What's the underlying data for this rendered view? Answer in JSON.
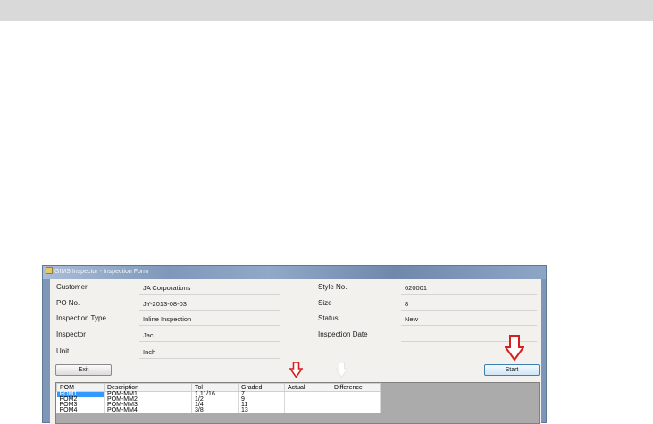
{
  "window": {
    "title": "GIMS Inspector - Inspection Form"
  },
  "form": {
    "fields_left": [
      {
        "label": "Customer",
        "value": "JA Corporations"
      },
      {
        "label": "PO No.",
        "value": "JY-2013-08-03"
      },
      {
        "label": "Inspection Type",
        "value": "Inline Inspection"
      },
      {
        "label": "Inspector",
        "value": "Jac"
      },
      {
        "label": "Unit",
        "value": "Inch"
      }
    ],
    "fields_right": [
      {
        "label": "Style No.",
        "value": "620001"
      },
      {
        "label": "Size",
        "value": "8"
      },
      {
        "label": "Status",
        "value": "New"
      },
      {
        "label": "Inspection Date",
        "value": ""
      }
    ]
  },
  "buttons": {
    "exit_label": "Exit",
    "start_label": "Start"
  },
  "table": {
    "columns": [
      "POM",
      "Description",
      "Tol",
      "Graded",
      "Actual",
      "Difference"
    ],
    "rows": [
      {
        "pom": "POM1",
        "description": "POM-MM1",
        "tol": "1 11/16",
        "graded": "7",
        "actual": "",
        "difference": ""
      },
      {
        "pom": "POM2",
        "description": "POM-MM2",
        "tol": "1/2",
        "graded": "9",
        "actual": "",
        "difference": ""
      },
      {
        "pom": "POM3",
        "description": "POM-MM3",
        "tol": "1/4",
        "graded": "11",
        "actual": "",
        "difference": ""
      },
      {
        "pom": "POM4",
        "description": "POM-MM4",
        "tol": "3/8",
        "graded": "13",
        "actual": "",
        "difference": ""
      }
    ],
    "selected_row_index": 0
  },
  "colors": {
    "highlight_arrow": "#d62020",
    "white_arrow": "#ffffff",
    "selection": "#3399ff",
    "top_band": "#d9d9d9"
  },
  "icons": [
    "app-icon",
    "down-arrow-icon"
  ]
}
